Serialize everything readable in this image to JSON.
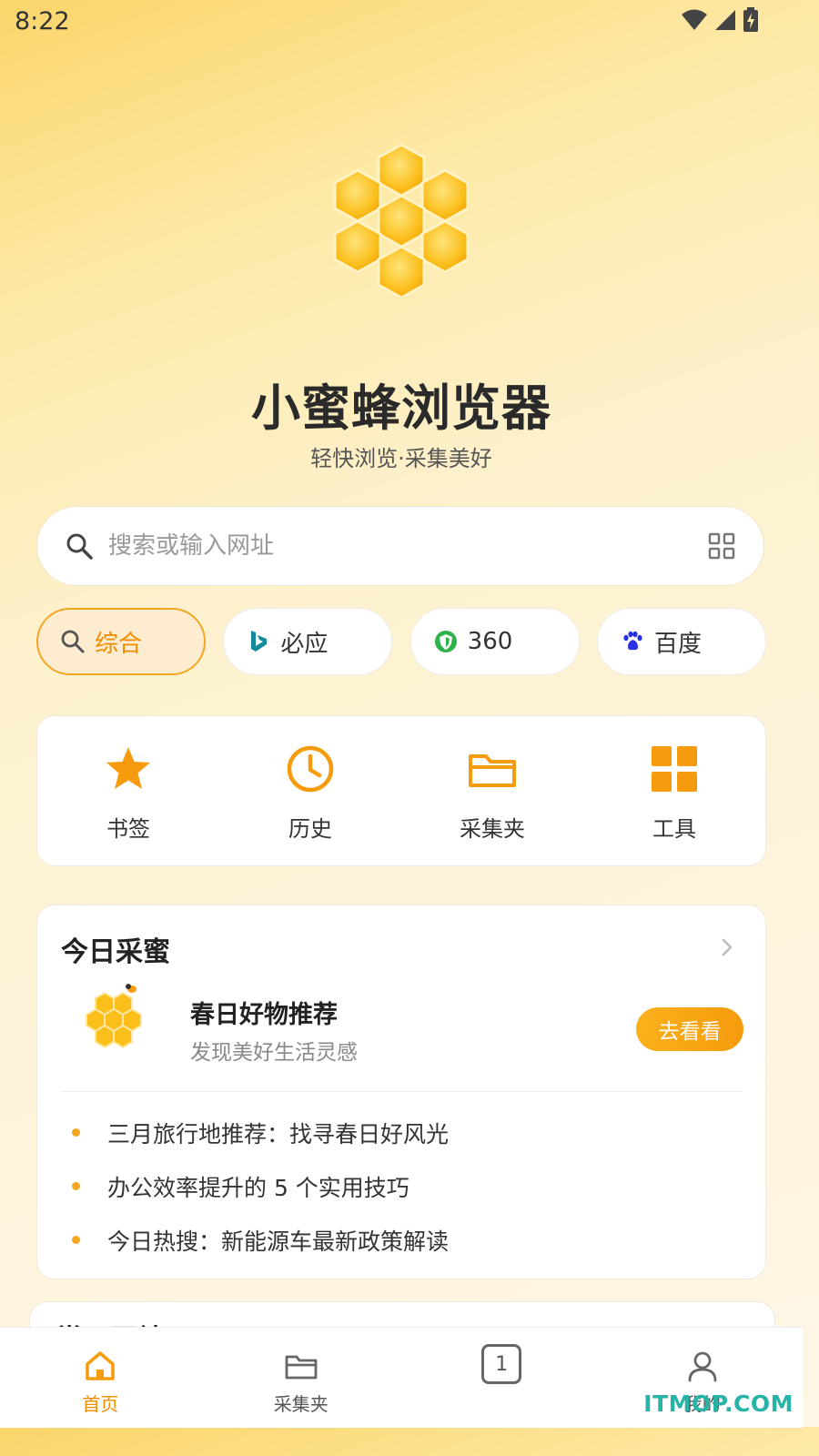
{
  "status_bar": {
    "time": "8:22"
  },
  "app": {
    "title": "小蜜蜂浏览器",
    "subtitle": "轻快浏览·采集美好"
  },
  "search": {
    "placeholder": "搜索或输入网址",
    "value": ""
  },
  "engines": [
    {
      "label": "综合",
      "icon": "search-icon",
      "active": true
    },
    {
      "label": "必应",
      "icon": "bing-icon",
      "active": false
    },
    {
      "label": "360",
      "icon": "360-shield-icon",
      "active": false
    },
    {
      "label": "百度",
      "icon": "baidu-paw-icon",
      "active": false
    }
  ],
  "quick_actions": [
    {
      "label": "书签",
      "icon": "star-icon"
    },
    {
      "label": "历史",
      "icon": "clock-icon"
    },
    {
      "label": "采集夹",
      "icon": "folder-icon"
    },
    {
      "label": "工具",
      "icon": "grid-icon"
    }
  ],
  "today_honey": {
    "title": "今日采蜜",
    "feature": {
      "title": "春日好物推荐",
      "subtitle": "发现美好生活灵感",
      "button": "去看看"
    },
    "news": [
      "三月旅行地推荐：找寻春日好风光",
      "办公效率提升的 5 个实用技巧",
      "今日热搜：新能源车最新政策解读"
    ]
  },
  "next_section": {
    "title": "常用网站"
  },
  "bottom_nav": [
    {
      "label": "首页",
      "icon": "home-icon",
      "active": true
    },
    {
      "label": "采集夹",
      "icon": "folder-icon",
      "active": false
    },
    {
      "label": "1",
      "icon": "tabs-icon",
      "active": false
    },
    {
      "label": "我的",
      "icon": "user-icon",
      "active": false
    }
  ],
  "watermark": "ITMOP.COM",
  "colors": {
    "accent": "#f5a623",
    "accent_text": "#f08c00",
    "watermark": "#27b3a6"
  }
}
